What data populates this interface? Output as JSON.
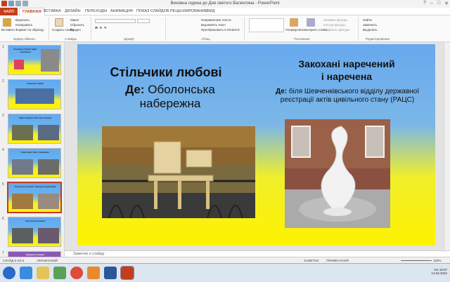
{
  "window": {
    "title": "Виховна година до Дня святого Валентина - PowerPoint",
    "help": "?",
    "minimize": "–",
    "maximize": "□",
    "close": "✕"
  },
  "ribbon_tabs": [
    "ФАЙЛ",
    "ГЛАВНАЯ",
    "ВСТАВКА",
    "ДИЗАЙН",
    "ПЕРЕХОДЫ",
    "АНИМАЦИЯ",
    "ПОКАЗ СЛАЙДОВ",
    "РЕЦЕНЗИРОВАНИЕ",
    "ВИД"
  ],
  "ribbon": {
    "clipboard": {
      "paste": "Вставить",
      "cut": "Вырезать",
      "copy": "Копировать",
      "format": "Формат по образцу",
      "label": "Буфер обмена"
    },
    "slides": {
      "new": "Создать слайд",
      "layout": "Макет",
      "reset": "Сбросить",
      "section": "Раздел",
      "label": "Слайды"
    },
    "font": {
      "label": "Шрифт"
    },
    "paragraph": {
      "dir": "Направление текста",
      "align": "Выровнять текст",
      "smartart": "Преобразовать в SmartArt",
      "label": "Абзац"
    },
    "drawing": {
      "arrange": "Упорядочить",
      "styles": "Экспресс-стили",
      "fill": "Заливка фигуры",
      "outline": "Контур фигуры",
      "effects": "Эффекты фигуры",
      "label": "Рисование"
    },
    "editing": {
      "find": "Найти",
      "replace": "Заменить",
      "select": "Выделить",
      "label": "Редактирование"
    }
  },
  "thumbnails": [
    {
      "num": "1",
      "text": "Кохання у Києві / Дню закоханих"
    },
    {
      "num": "2",
      "text": "Кохання у Києві"
    },
    {
      "num": "3",
      "text": "Арка кохання / Фонтан кохання"
    },
    {
      "num": "4",
      "text": "Пам'ятник / Міст закоханих"
    },
    {
      "num": "5",
      "text": "Стільчики любові / Закохані наречений"
    },
    {
      "num": "6",
      "text": "Інші місця кохання"
    },
    {
      "num": "7",
      "text": "Бажаємо кохання"
    }
  ],
  "slide": {
    "left_title": "Стільчики любові",
    "left_de_label": "Де:",
    "left_location": "Оболонська набережна",
    "right_title_1": "Закохані наречений",
    "right_title_2": "і наречена",
    "right_de_label": "Де:",
    "right_location": "біля Шевченківського відділу державної реєстрації актів цивільного стану (РАЦС)"
  },
  "notes": {
    "placeholder": "Заметки к слайду"
  },
  "status": {
    "slide_info": "СЛАЙД 5 ИЗ 8",
    "language": "УКРАИНСКИЙ",
    "notes_btn": "ЗАМЕТКИ",
    "comments_btn": "ПРИМЕЧАНИЯ",
    "zoom": "100%"
  },
  "tray": {
    "lang": "UK",
    "time": "15:07",
    "date": "14.02.2022"
  },
  "colors": {
    "accent": "#c43e1c",
    "slide_top": "#67a9ee",
    "slide_bottom": "#fff200"
  }
}
